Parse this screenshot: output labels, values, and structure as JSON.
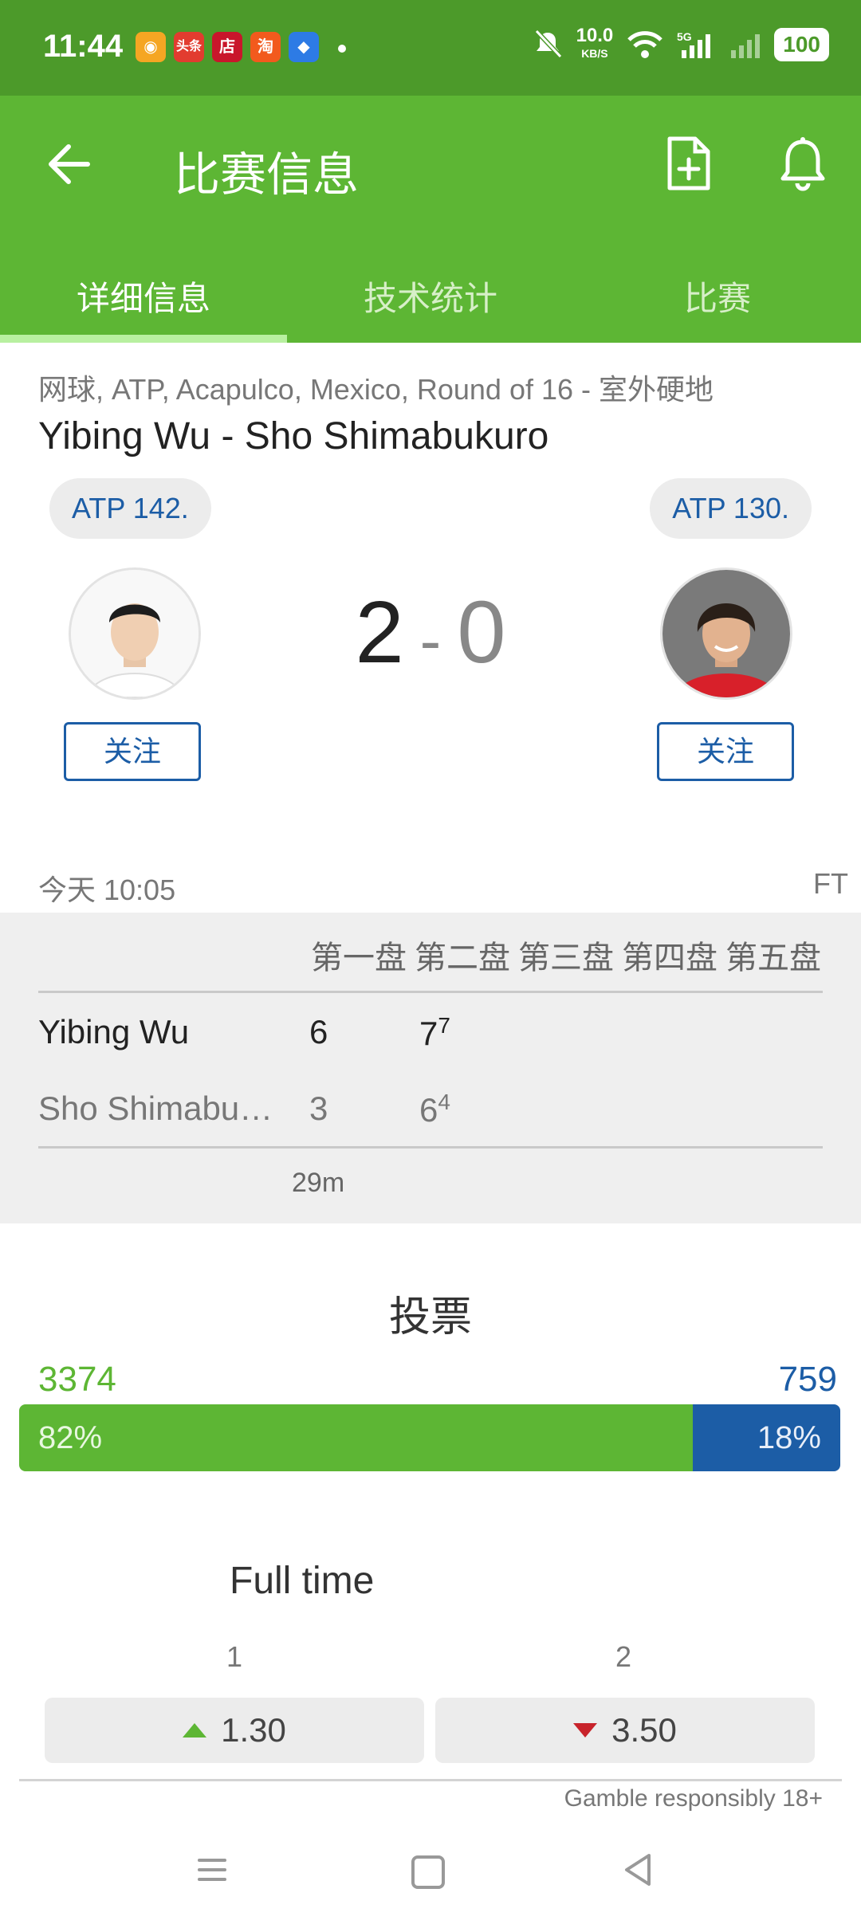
{
  "status_bar": {
    "time": "11:44",
    "app_icons": [
      "weibo",
      "头条",
      "店",
      "淘",
      "browser"
    ],
    "net_speed": "10.0",
    "net_speed_unit": "KB/S",
    "network": "5G",
    "battery": "100"
  },
  "app_bar": {
    "title": "比赛信息",
    "tabs": [
      {
        "label": "详细信息",
        "active": true
      },
      {
        "label": "技术统计",
        "active": false
      },
      {
        "label": "比赛",
        "active": false
      }
    ]
  },
  "match": {
    "meta": "网球, ATP, Acapulco, Mexico, Round of 16 - 室外硬地",
    "title": "Yibing Wu - Sho Shimabukuro",
    "home": {
      "rank": "ATP 142.",
      "follow_label": "关注"
    },
    "away": {
      "rank": "ATP 130.",
      "follow_label": "关注"
    },
    "score_home": "2",
    "score_sep": "-",
    "score_away": "0",
    "date": "今天 10:05",
    "status": "FT"
  },
  "score_table": {
    "set_headers": [
      "第一盘",
      "第二盘",
      "第三盘",
      "第四盘",
      "第五盘"
    ],
    "rows": [
      {
        "name": "Yibing Wu",
        "set1": "6",
        "set2": "7",
        "set2_tb": "7"
      },
      {
        "name": "Sho Shimabu…",
        "set1": "3",
        "set2": "6",
        "set2_tb": "4"
      }
    ],
    "duration": "29m"
  },
  "vote": {
    "title": "投票",
    "home_count": "3374",
    "away_count": "759",
    "home_pct": "82%",
    "away_pct": "18%",
    "home_fraction": 0.82,
    "colors": {
      "home": "#5db634",
      "away": "#1c5da6"
    }
  },
  "odds": {
    "title": "Full time",
    "home_label": "1",
    "away_label": "2",
    "home_value": "1.30",
    "away_value": "3.50",
    "disclaimer": "Gamble responsibly 18+"
  },
  "colors": {
    "status_bar": "#4c9a2a",
    "app_bar": "#5db634",
    "accent_blue": "#1c5da6"
  }
}
